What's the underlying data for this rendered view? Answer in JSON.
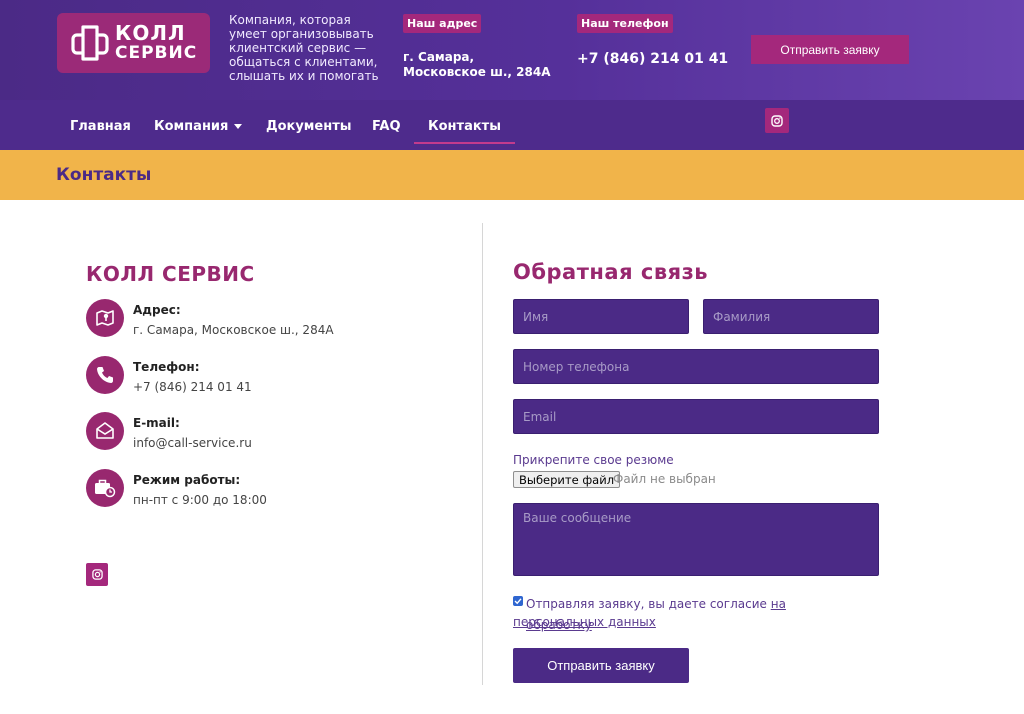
{
  "header": {
    "logo": {
      "line1": "КОЛЛ",
      "line2": "СЕРВИС"
    },
    "tagline": "Компания, которая умеет организовывать клиентский сервис — общаться с клиентами, слышать их и помогать",
    "address_chip": "Наш адрес",
    "address": "г. Самара, Московское ш., 284А",
    "phone_chip": "Наш телефон",
    "phone": "+7 (846) 214 01 41",
    "cta": "Отправить заявку"
  },
  "nav": {
    "items": [
      {
        "label": "Главная"
      },
      {
        "label": "Компания"
      },
      {
        "label": "Документы"
      },
      {
        "label": "FAQ"
      },
      {
        "label": "Контакты"
      }
    ],
    "active": "Контакты"
  },
  "page": {
    "title": "Контакты"
  },
  "company": {
    "name": "КОЛЛ СЕРВИС",
    "address_label": "Адрес:",
    "address": "г. Самара, Московское ш., 284А",
    "phone_label": "Телефон:",
    "phone": "+7 (846) 214 01 41",
    "email_label": "E-mail:",
    "email": "info@call-service.ru",
    "hours_label": "Режим работы:",
    "hours": "пн-пт с 9:00 до 18:00"
  },
  "form": {
    "title": "Обратная связь",
    "first_name_placeholder": "Имя",
    "last_name_placeholder": "Фамилия",
    "phone_placeholder": "Номер телефона",
    "email_placeholder": "Email",
    "attach_label": "Прикрепите свое резюме",
    "file_button": "Выберите файл",
    "file_status": "Файл не выбран",
    "message_placeholder": "Ваше сообщение",
    "consent_text": "Отправляя заявку, вы даете согласие",
    "consent_link_1": "на обработку",
    "consent_link_2": "персональных данных",
    "consent_checked": true,
    "submit": "Отправить заявку"
  },
  "icons": [
    "instagram-icon",
    "map-icon",
    "phone-icon",
    "mail-icon",
    "briefcase-clock-icon"
  ],
  "colors": {
    "purple": "#4b2a86",
    "magenta": "#98286f",
    "yellow": "#f1b44a"
  }
}
